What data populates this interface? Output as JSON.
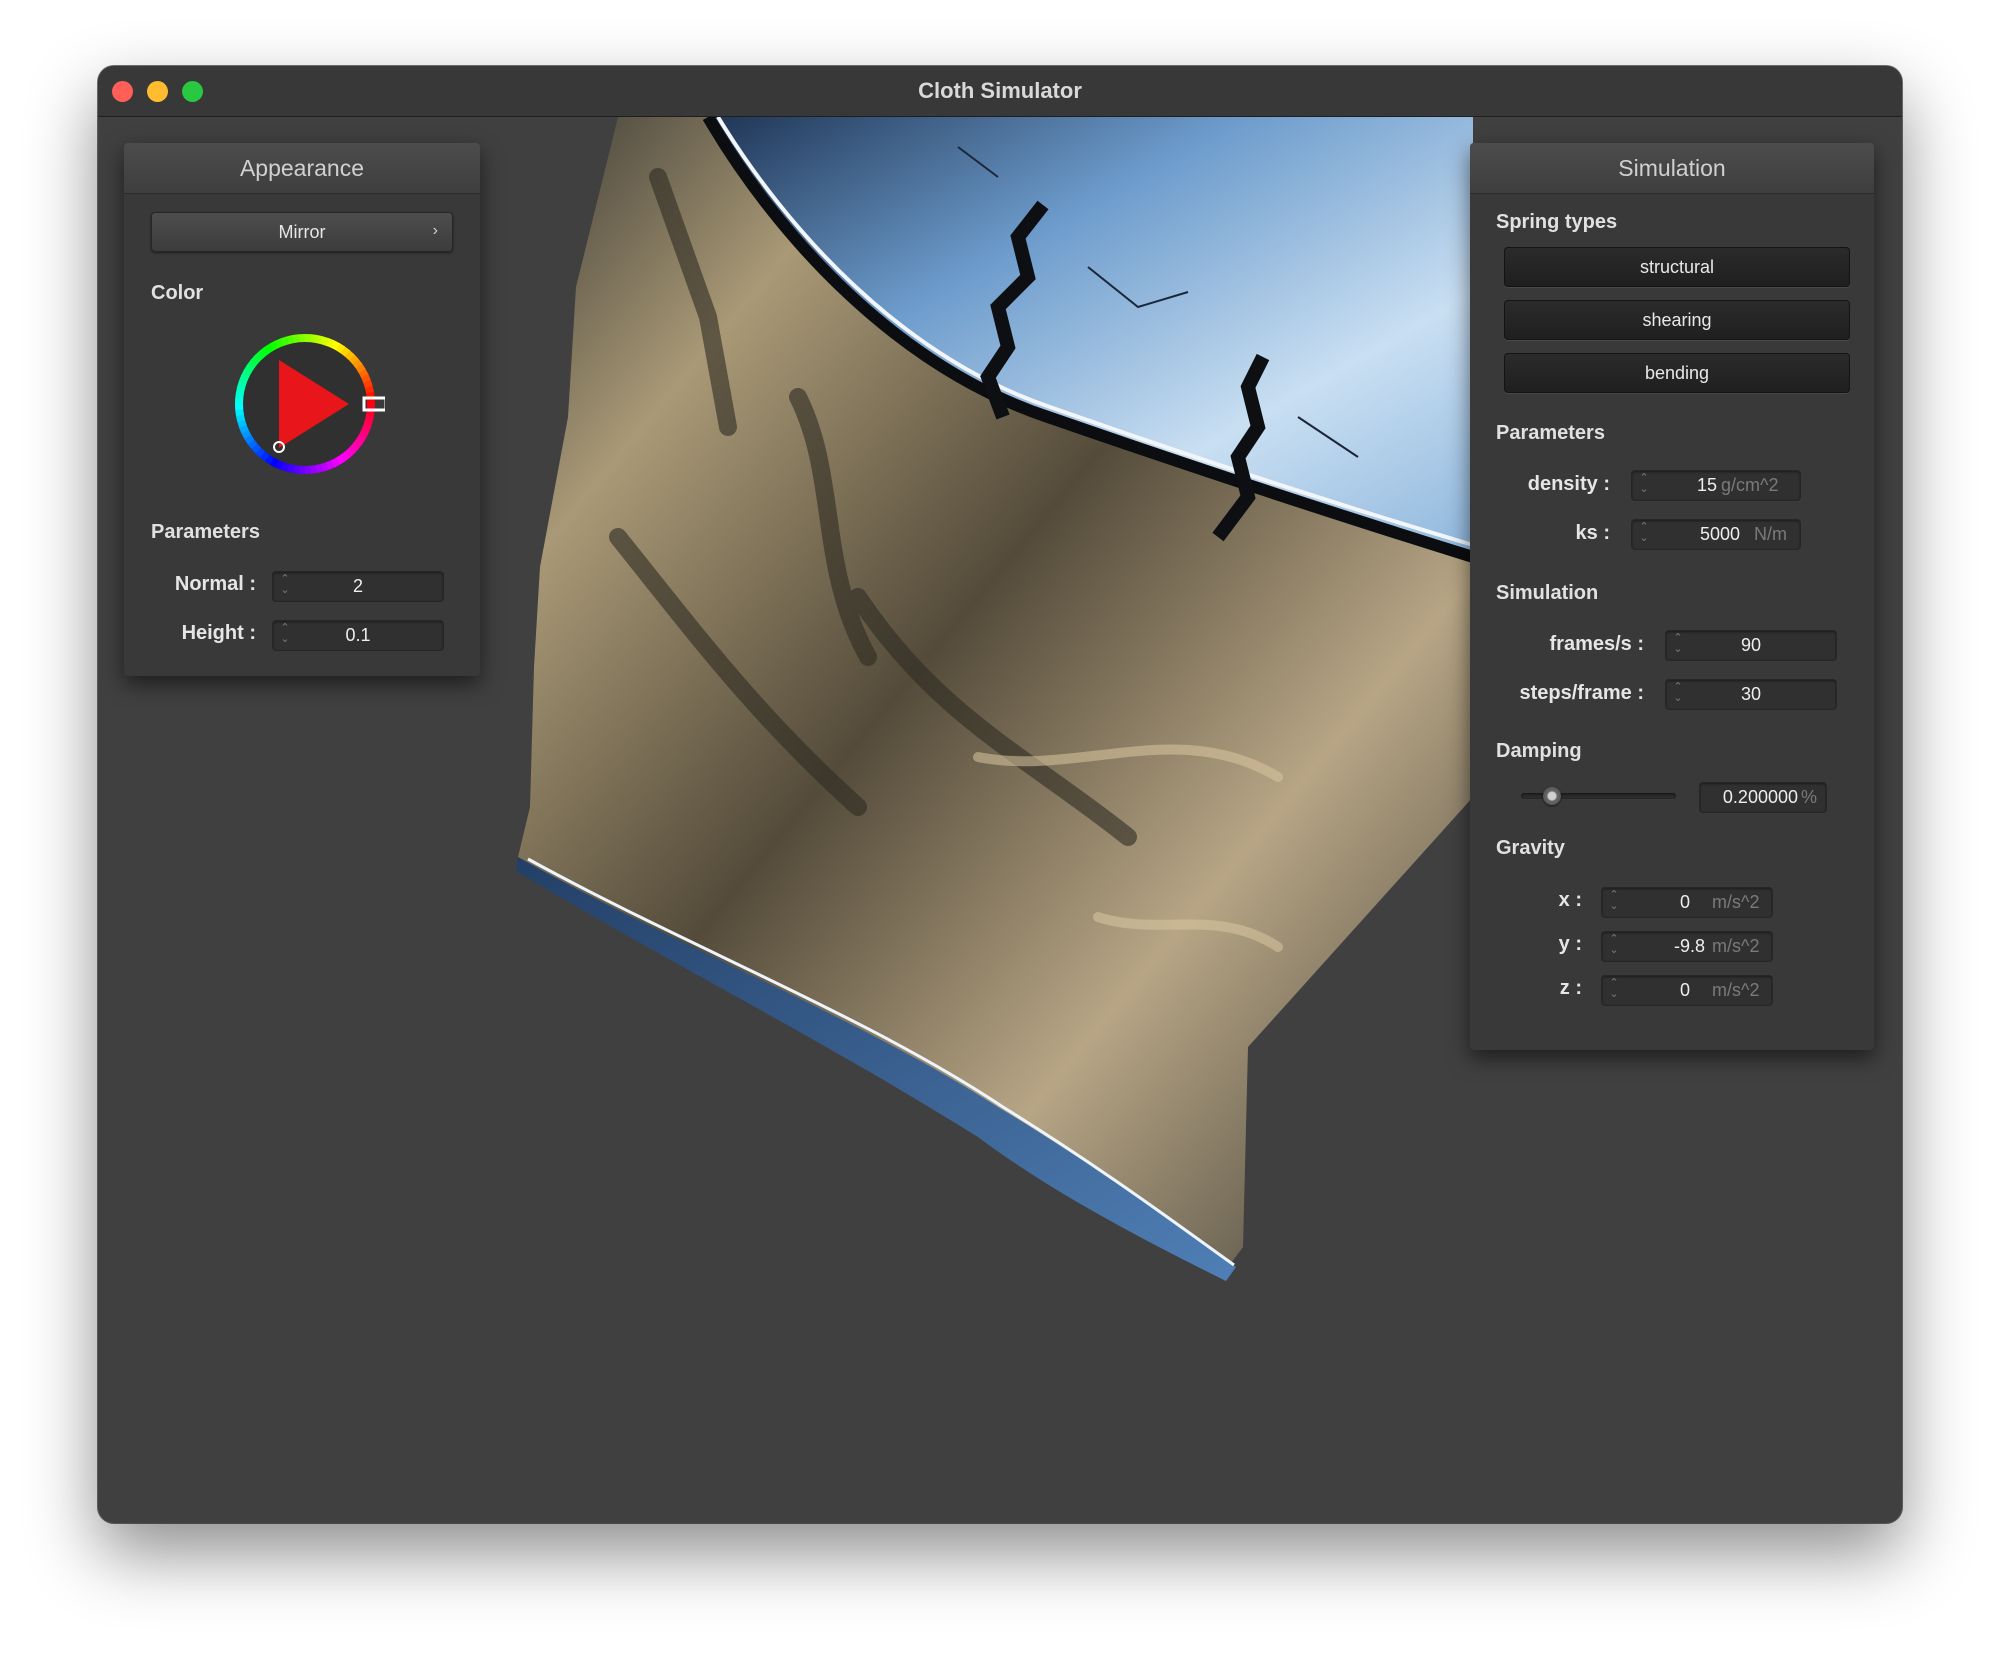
{
  "window": {
    "title": "Cloth Simulator"
  },
  "appearance": {
    "header": "Appearance",
    "shader_label": "Mirror",
    "color_label": "Color",
    "selected_color": "#e8151b",
    "parameters_label": "Parameters",
    "normal": {
      "label": "Normal :",
      "value": "2"
    },
    "height": {
      "label": "Height :",
      "value": "0.1"
    }
  },
  "simulation": {
    "header": "Simulation",
    "spring_types_label": "Spring types",
    "spring_buttons": [
      "structural",
      "shearing",
      "bending"
    ],
    "parameters_label": "Parameters",
    "density": {
      "label": "density :",
      "value": "15",
      "unit": "g/cm^2"
    },
    "ks": {
      "label": "ks :",
      "value": "5000",
      "unit": "N/m"
    },
    "simulation_label": "Simulation",
    "frames_per_second": {
      "label": "frames/s :",
      "value": "90"
    },
    "steps_per_frame": {
      "label": "steps/frame :",
      "value": "30"
    },
    "damping_label": "Damping",
    "damping": {
      "value": "0.200000",
      "unit": "%",
      "slider_fraction": 0.2
    },
    "gravity_label": "Gravity",
    "gravity_x": {
      "label": "x :",
      "value": "0",
      "unit": "m/s^2"
    },
    "gravity_y": {
      "label": "y :",
      "value": "-9.8",
      "unit": "m/s^2"
    },
    "gravity_z": {
      "label": "z :",
      "value": "0",
      "unit": "m/s^2"
    }
  },
  "icons": {
    "close": "close-dot-icon",
    "minimize": "minimize-dot-icon",
    "maximize": "maximize-dot-icon",
    "dropdown": "chevron-right-icon",
    "spinner": "stepper-icon"
  }
}
